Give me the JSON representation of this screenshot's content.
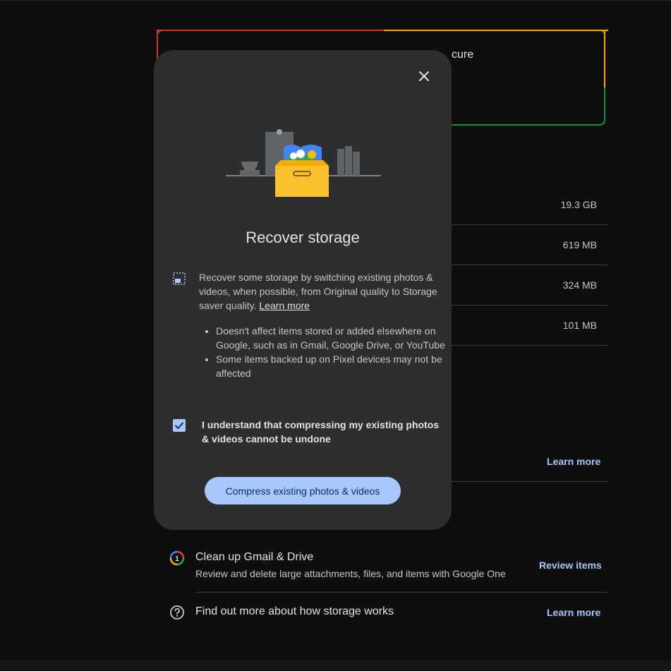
{
  "background": {
    "status_title_partial": "cure",
    "storage_rows": [
      {
        "size": "19.3 GB"
      },
      {
        "size": "619 MB"
      },
      {
        "size": "324 MB"
      },
      {
        "size": "101 MB"
      }
    ],
    "learn_more_link": "Learn more",
    "tools": [
      {
        "icon": "google-one-icon",
        "title": "Clean up Gmail & Drive",
        "description": "Review and delete large attachments, files, and items with Google One",
        "action": "Review items"
      },
      {
        "icon": "help-circle-icon",
        "title": "Find out more about how storage works",
        "action": "Learn more"
      }
    ]
  },
  "modal": {
    "title": "Recover storage",
    "info_text": "Recover some storage by switching existing photos & videos, when possible, from Original quality to Storage saver quality.",
    "info_link": "Learn more",
    "bullets": [
      "Doesn't affect items stored or added elsewhere on Google, such as in Gmail, Google Drive, or YouTube",
      "Some items backed up on Pixel devices may not be affected"
    ],
    "checkbox_label": "I understand that compressing my existing photos & videos cannot be undone",
    "checkbox_checked": true,
    "button_label": "Compress existing photos & videos"
  },
  "colors": {
    "accent": "#a8c7fa",
    "modal_bg": "#2d2e30",
    "page_bg": "#0e0e0e"
  }
}
